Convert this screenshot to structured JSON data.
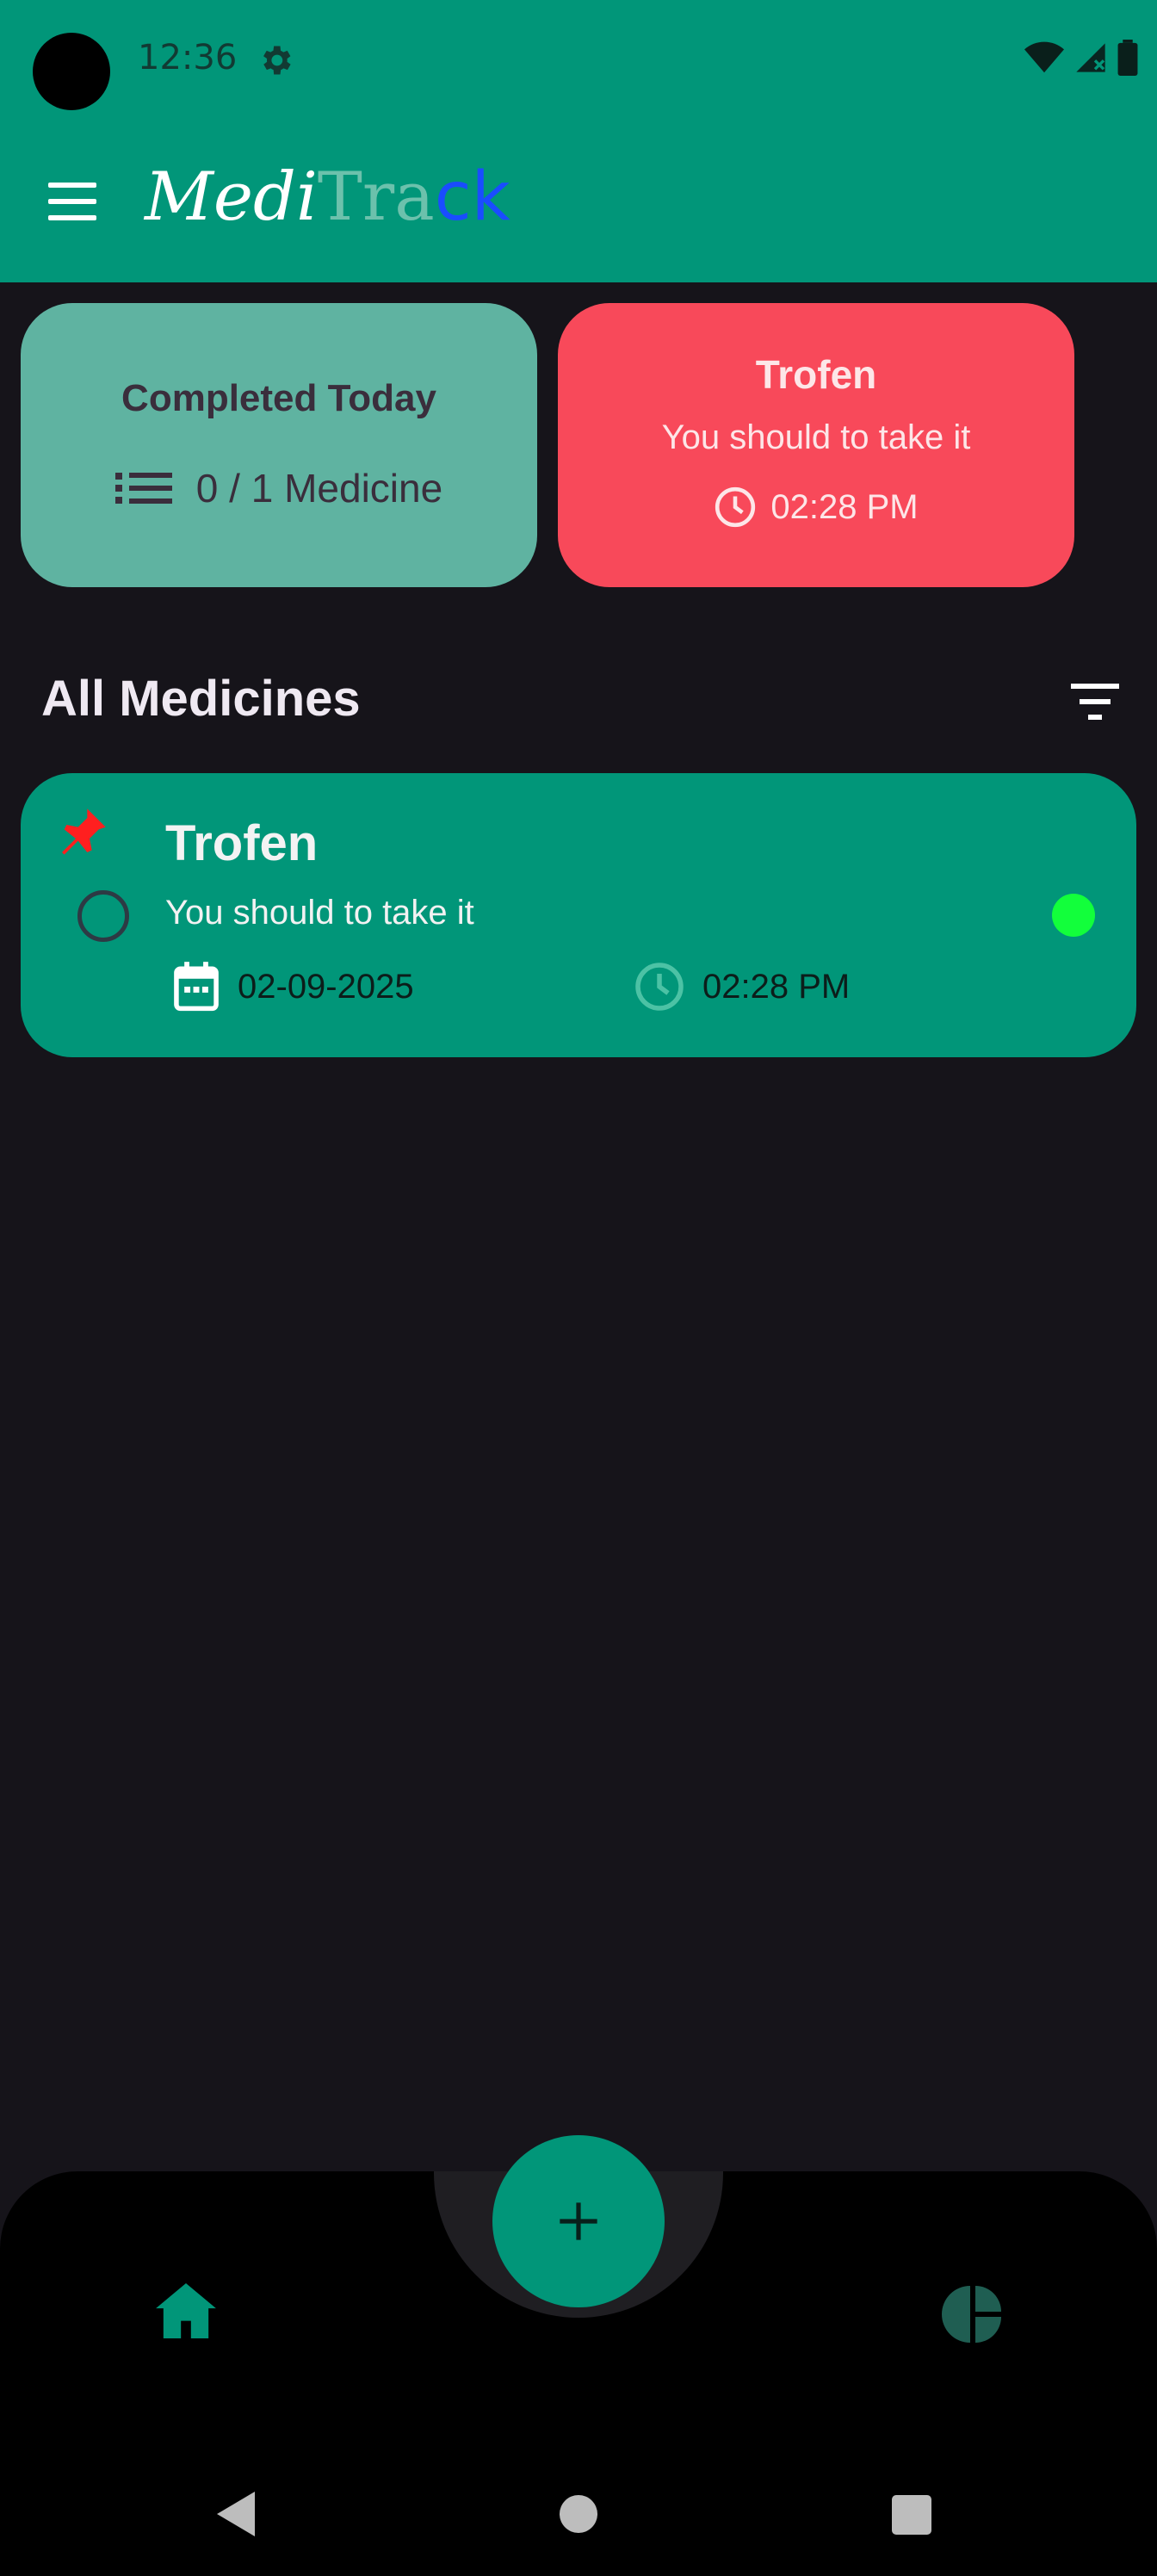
{
  "status_bar": {
    "time": "12:36"
  },
  "app": {
    "logo_part1": "Medi",
    "logo_part2": "Tra",
    "logo_part3": "ck"
  },
  "completed_card": {
    "title": "Completed Today",
    "count_text": "0 / 1 Medicine"
  },
  "next_card": {
    "name": "Trofen",
    "message": "You should to take it",
    "time": "02:28 PM"
  },
  "section": {
    "title": "All Medicines"
  },
  "medicines": [
    {
      "name": "Trofen",
      "message": "You should to take it",
      "date": "02-09-2025",
      "time": "02:28 PM",
      "status_color": "#12ff3b",
      "pinned": true
    }
  ],
  "colors": {
    "primary": "#019679",
    "background": "#16141a",
    "alert": "#f8495a",
    "completed_card": "#5fb3a1"
  },
  "icons": [
    "settings-gear-icon",
    "wifi-icon",
    "signal-icon",
    "battery-icon",
    "menu-icon",
    "list-icon",
    "clock-icon",
    "filter-icon",
    "pin-icon",
    "calendar-icon",
    "plus-icon",
    "home-icon",
    "pie-chart-icon"
  ]
}
